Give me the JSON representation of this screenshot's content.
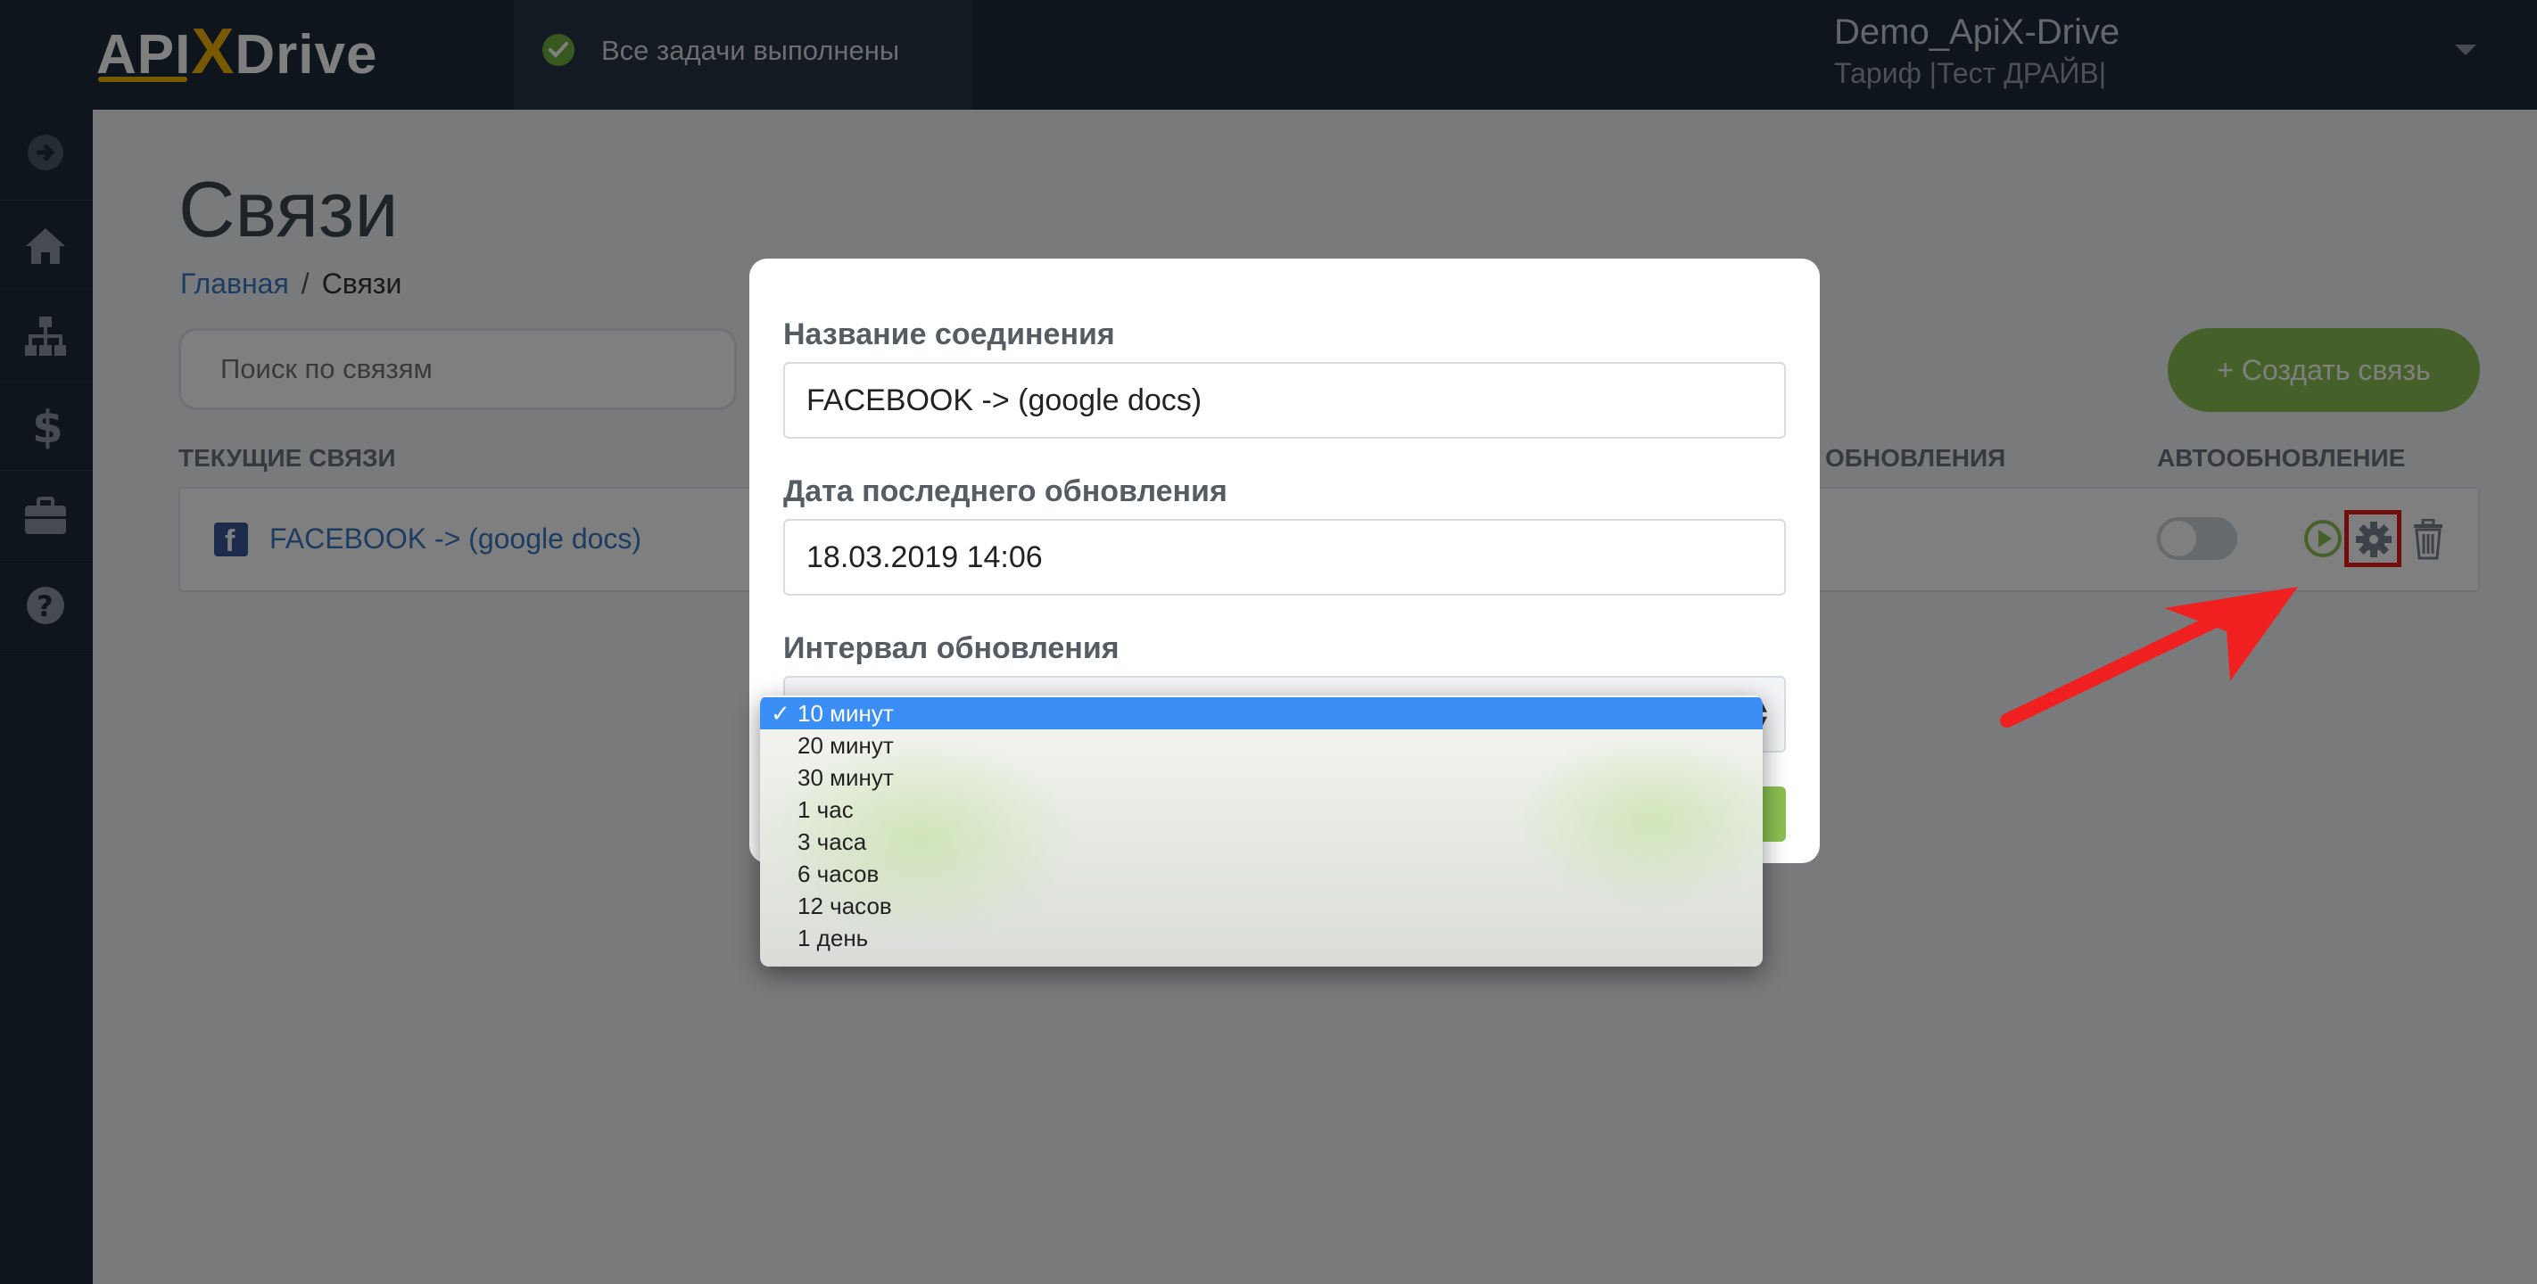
{
  "header": {
    "logo_api": "API",
    "logo_x": "X",
    "logo_drive": "Drive",
    "status_text": "Все задачи выполнены",
    "user_name": "Demo_ApiX-Drive",
    "user_plan": "Тариф |Тест ДРАЙВ|"
  },
  "sidebar": {
    "items": [
      {
        "icon": "arrow-right-circle-icon"
      },
      {
        "icon": "home-icon"
      },
      {
        "icon": "sitemap-icon"
      },
      {
        "icon": "dollar-icon"
      },
      {
        "icon": "briefcase-icon"
      },
      {
        "icon": "question-circle-icon"
      }
    ]
  },
  "page": {
    "title": "Связи",
    "breadcrumb_home": "Главная",
    "breadcrumb_sep": "/",
    "breadcrumb_current": "Связи",
    "search_placeholder": "Поиск по связям",
    "create_button": "+ Создать связь",
    "col_current": "ТЕКУЩИЕ СВЯЗИ",
    "col_update": "ОБНОВЛЕНИЯ",
    "col_autoupdate": "АВТООБНОВЛЕНИЕ",
    "connection_name": "FACEBOOK -> (google docs)"
  },
  "modal": {
    "name_label": "Название соединения",
    "name_value": "FACEBOOK -> (google docs)",
    "date_label": "Дата последнего обновления",
    "date_value": "18.03.2019 14:06",
    "interval_label": "Интервал обновления",
    "interval_selected": "10 минут",
    "interval_options": [
      "10 минут",
      "20 минут",
      "30 минут",
      "1 час",
      "3 часа",
      "6 часов",
      "12 часов",
      "1 день"
    ]
  },
  "colors": {
    "accent_green": "#8cc152",
    "nav_bg": "#1f2a38",
    "link_blue": "#3a78c2",
    "highlight_red": "#e21b1b",
    "selection_blue": "#3a8ef6"
  }
}
